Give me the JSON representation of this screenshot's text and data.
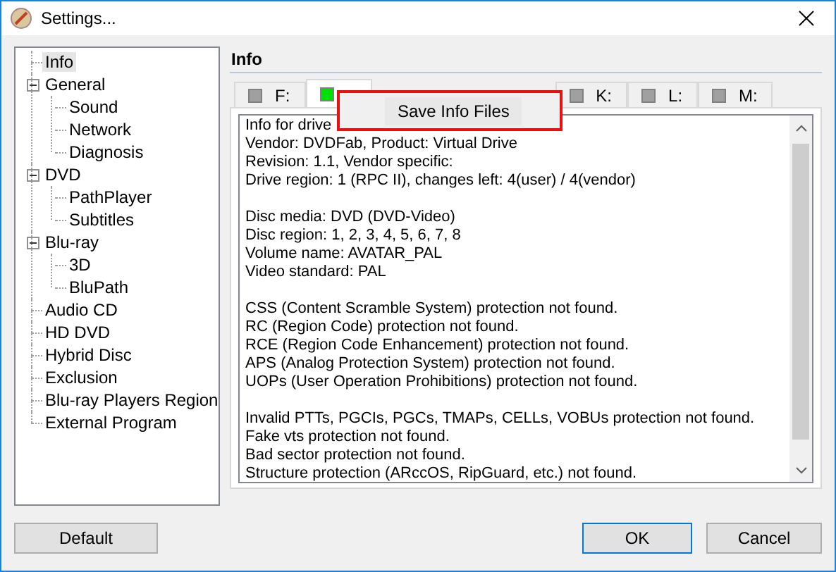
{
  "window": {
    "title": "Settings..."
  },
  "tree": [
    {
      "label": "Info",
      "selected": true
    },
    {
      "label": "General",
      "selected": false,
      "expanded": true,
      "children": [
        {
          "label": "Sound",
          "selected": false
        },
        {
          "label": "Network",
          "selected": false
        },
        {
          "label": "Diagnosis",
          "selected": false
        }
      ]
    },
    {
      "label": "DVD",
      "selected": false,
      "expanded": true,
      "children": [
        {
          "label": "PathPlayer",
          "selected": false
        },
        {
          "label": "Subtitles",
          "selected": false
        }
      ]
    },
    {
      "label": "Blu-ray",
      "selected": false,
      "expanded": true,
      "children": [
        {
          "label": "3D",
          "selected": false
        },
        {
          "label": "BluPath",
          "selected": false
        }
      ]
    },
    {
      "label": "Audio CD",
      "selected": false
    },
    {
      "label": "HD DVD",
      "selected": false
    },
    {
      "label": "Hybrid Disc",
      "selected": false
    },
    {
      "label": "Exclusion",
      "selected": false
    },
    {
      "label": "Blu-ray Players Region",
      "selected": false
    },
    {
      "label": "External Program",
      "selected": false
    }
  ],
  "section_title": "Info",
  "drive_tabs": [
    {
      "label": "F:",
      "selected": false,
      "color": "#a0a0a0"
    },
    {
      "selected": true,
      "color": "#00e000"
    },
    {
      "label": "K:",
      "selected": false,
      "color": "#a0a0a0"
    },
    {
      "label": "L:",
      "selected": false,
      "color": "#a0a0a0"
    },
    {
      "label": "M:",
      "selected": false,
      "color": "#a0a0a0"
    }
  ],
  "context_menu": {
    "items": [
      "Save Info Files"
    ]
  },
  "info_paragraphs": [
    [
      "Info for drive",
      "Vendor: DVDFab, Product: Virtual Drive",
      "Revision: 1.1, Vendor specific:",
      "Drive region: 1 (RPC II), changes left: 4(user) / 4(vendor)"
    ],
    [
      "Disc media: DVD (DVD-Video)",
      "Disc region: 1, 2, 3, 4, 5, 6, 7, 8",
      "Volume name: AVATAR_PAL",
      "Video standard: PAL"
    ],
    [
      "CSS (Content Scramble System) protection not found.",
      "RC (Region Code) protection not found.",
      "RCE (Region Code Enhancement) protection not found.",
      "APS (Analog Protection System) protection not found.",
      "UOPs (User Operation Prohibitions) protection not found."
    ],
    [
      "Invalid PTTs, PGCIs, PGCs, TMAPs, CELLs, VOBUs protection not found.",
      "Fake vts protection not found.",
      "Bad sector protection not found.",
      "Structure protection (ARccOS, RipGuard, etc.) not found."
    ]
  ],
  "buttons": {
    "left": "Default",
    "ok": "OK",
    "cancel": "Cancel"
  }
}
